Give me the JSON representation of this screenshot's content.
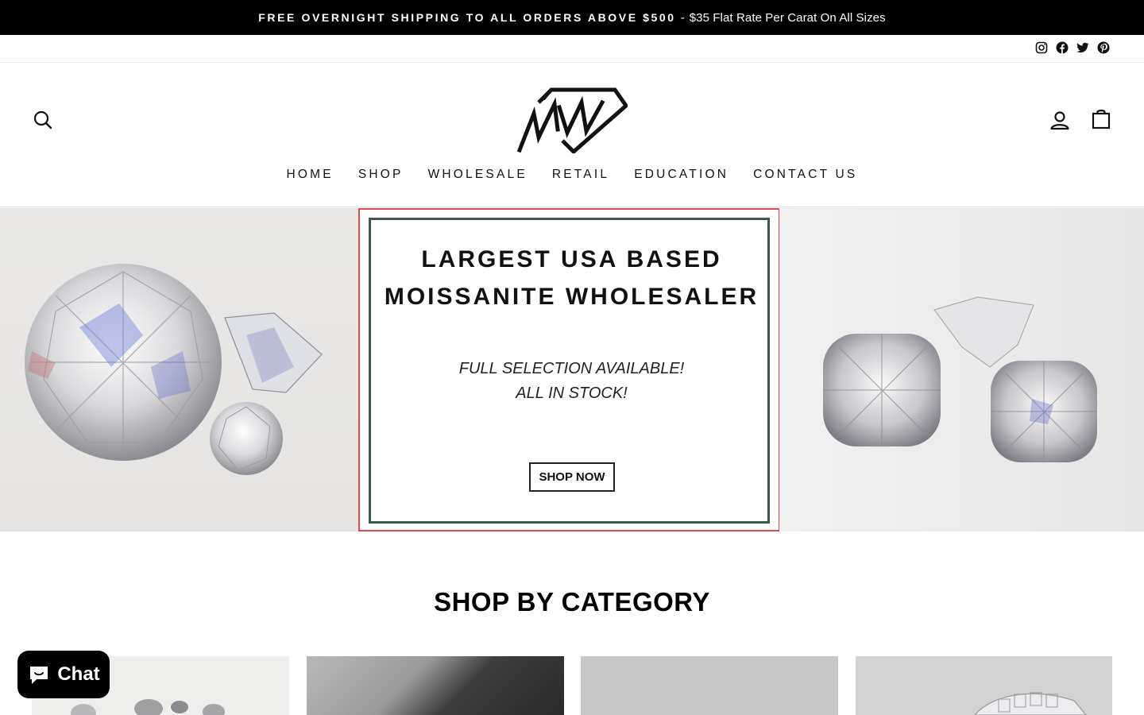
{
  "announcement": {
    "strong": "FREE OVERNIGHT SHIPPING TO ALL ORDERS ABOVE $500",
    "separator": "-",
    "rest": "$35 Flat Rate Per Carat On All Sizes"
  },
  "social": [
    "instagram-icon",
    "facebook-icon",
    "twitter-icon",
    "pinterest-icon"
  ],
  "header": {
    "logo_text": "MW",
    "icons": [
      "search-icon",
      "account-icon",
      "cart-icon"
    ]
  },
  "nav": [
    "HOME",
    "SHOP",
    "WHOLESALE",
    "RETAIL",
    "EDUCATION",
    "CONTACT US"
  ],
  "hero": {
    "title_line1": "LARGEST USA BASED",
    "title_line2": "MOISSANITE WHOLESALER",
    "sub_line1": "FULL SELECTION AVAILABLE!",
    "sub_line2": "ALL IN STOCK!",
    "cta": "SHOP NOW"
  },
  "section": {
    "title": "SHOP BY CATEGORY"
  },
  "chat": {
    "label": "Chat"
  },
  "colors": {
    "announce_bg": "#000000",
    "hero_border": "#e14a4a",
    "hero_inner_border": "#3a5a4a"
  }
}
